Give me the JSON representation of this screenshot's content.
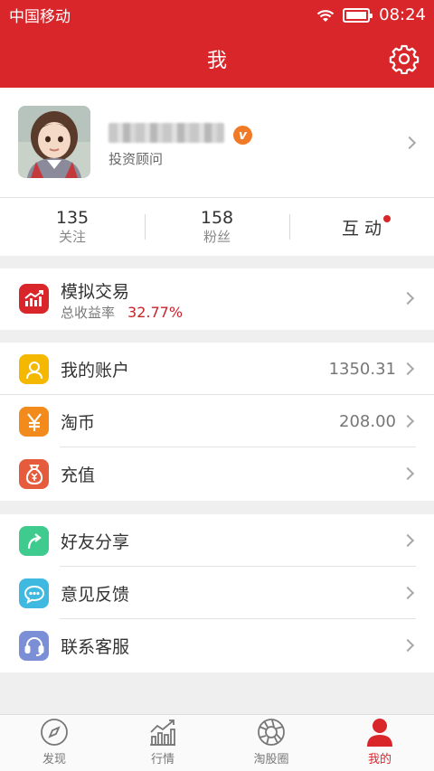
{
  "status_bar": {
    "carrier": "中国移动",
    "time": "08:24"
  },
  "header": {
    "title": "我",
    "settings_icon": "gear-icon"
  },
  "profile": {
    "name_hidden": true,
    "badge": "v",
    "role": "投资顾问",
    "avatar_icon": "avatar"
  },
  "stats": [
    {
      "value": "135",
      "label": "关注"
    },
    {
      "value": "158",
      "label": "粉丝"
    }
  ],
  "interact": {
    "label": "互 动",
    "has_notification": true
  },
  "simulated_trade": {
    "title": "模拟交易",
    "sub_label": "总收益率",
    "sub_value": "32.77%",
    "icon": "chart-up-icon",
    "icon_color": "#d9262b"
  },
  "account_menu": [
    {
      "label": "我的账户",
      "value": "1350.31",
      "icon": "user-icon",
      "color": "#f4b800"
    },
    {
      "label": "淘币",
      "value": "208.00",
      "icon": "yen-icon",
      "color": "#f28a1c"
    },
    {
      "label": "充值",
      "value": "",
      "icon": "money-bag-icon",
      "color": "#e55b3c"
    }
  ],
  "social_menu": [
    {
      "label": "好友分享",
      "icon": "share-icon",
      "color": "#3fcb8e"
    },
    {
      "label": "意见反馈",
      "icon": "chat-icon",
      "color": "#3fb9e0"
    },
    {
      "label": "联系客服",
      "icon": "headset-icon",
      "color": "#7b8fd6"
    }
  ],
  "tabbar": [
    {
      "label": "发现",
      "icon": "compass-icon",
      "active": false
    },
    {
      "label": "行情",
      "icon": "trend-chart-icon",
      "active": false
    },
    {
      "label": "淘股圈",
      "icon": "aperture-icon",
      "active": false
    },
    {
      "label": "我的",
      "icon": "person-icon",
      "active": true
    }
  ],
  "colors": {
    "brand_red": "#d9262b",
    "profit_red": "#c8232a",
    "background": "#efefef"
  }
}
